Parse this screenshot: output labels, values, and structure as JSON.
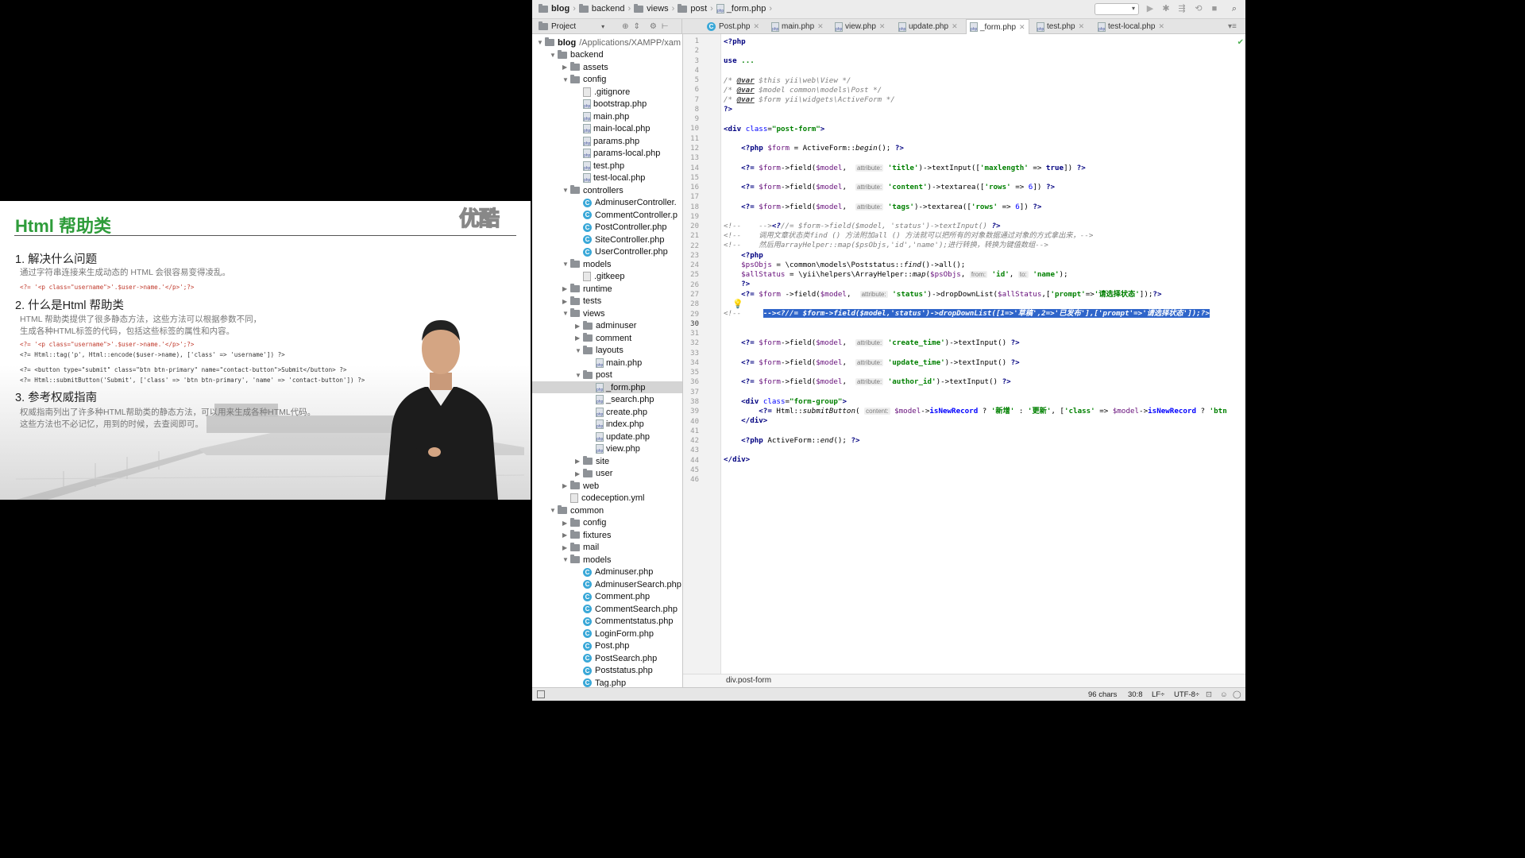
{
  "slide": {
    "title": "Html 帮助类",
    "logo": "优酷",
    "s1_head": "1. 解决什么问题",
    "s1_text": "通过字符串连接来生成动态的 HTML 会很容易变得凌乱。",
    "s1_code": "<?= '<p class=\"username\">'.$user->name.'</p>';?>",
    "s2_head": "2. 什么是Html 帮助类",
    "s2_text1": "HTML 帮助类提供了很多静态方法，这些方法可以根据参数不同，",
    "s2_text2": "生成各种HTML标签的代码，包括这些标签的属性和内容。",
    "s2_code1": "<?= '<p class=\"username\">'.$user->name.'</p>';?>",
    "s2_code2": "<?= Html::tag('p', Html::encode($user->name), ['class' => 'username']) ?>",
    "s2_code3": "<?= <button type=\"submit\" class=\"btn btn-primary\" name=\"contact-button\">Submit</button> ?>",
    "s2_code4": "<?= Html::submitButton('Submit', ['class' => 'btn btn-primary', 'name' => 'contact-button']) ?>",
    "s3_head": "3. 参考权威指南",
    "s3_text1": "权威指南列出了许多种HTML帮助类的静态方法，可以用来生成各种HTML代码。",
    "s3_text2": "这些方法也不必记忆，用到的时候，去查阅即可。"
  },
  "breadcrumb": [
    "blog",
    "backend",
    "views",
    "post",
    "_form.php"
  ],
  "tabs": {
    "project": "Project",
    "files": [
      "Post.php",
      "main.php",
      "view.php",
      "update.php",
      "_form.php",
      "test.php",
      "test-local.php"
    ],
    "active": "_form.php"
  },
  "tree": [
    {
      "label": "blog",
      "extra": "/Applications/XAMPP/xam",
      "depth": 0,
      "kind": "root",
      "open": true
    },
    {
      "label": "backend",
      "depth": 1,
      "kind": "folder",
      "open": true
    },
    {
      "label": "assets",
      "depth": 2,
      "kind": "folder",
      "open": false
    },
    {
      "label": "config",
      "depth": 2,
      "kind": "folder",
      "open": true
    },
    {
      "label": ".gitignore",
      "depth": 3,
      "kind": "file"
    },
    {
      "label": "bootstrap.php",
      "depth": 3,
      "kind": "php"
    },
    {
      "label": "main.php",
      "depth": 3,
      "kind": "php"
    },
    {
      "label": "main-local.php",
      "depth": 3,
      "kind": "php"
    },
    {
      "label": "params.php",
      "depth": 3,
      "kind": "php"
    },
    {
      "label": "params-local.php",
      "depth": 3,
      "kind": "php"
    },
    {
      "label": "test.php",
      "depth": 3,
      "kind": "php"
    },
    {
      "label": "test-local.php",
      "depth": 3,
      "kind": "php"
    },
    {
      "label": "controllers",
      "depth": 2,
      "kind": "folder",
      "open": true
    },
    {
      "label": "AdminuserController.",
      "depth": 3,
      "kind": "class"
    },
    {
      "label": "CommentController.p",
      "depth": 3,
      "kind": "class"
    },
    {
      "label": "PostController.php",
      "depth": 3,
      "kind": "class"
    },
    {
      "label": "SiteController.php",
      "depth": 3,
      "kind": "class"
    },
    {
      "label": "UserController.php",
      "depth": 3,
      "kind": "class"
    },
    {
      "label": "models",
      "depth": 2,
      "kind": "folder",
      "open": true
    },
    {
      "label": ".gitkeep",
      "depth": 3,
      "kind": "file"
    },
    {
      "label": "runtime",
      "depth": 2,
      "kind": "folder",
      "open": false
    },
    {
      "label": "tests",
      "depth": 2,
      "kind": "folder",
      "open": false
    },
    {
      "label": "views",
      "depth": 2,
      "kind": "folder",
      "open": true
    },
    {
      "label": "adminuser",
      "depth": 3,
      "kind": "folder",
      "open": false
    },
    {
      "label": "comment",
      "depth": 3,
      "kind": "folder",
      "open": false
    },
    {
      "label": "layouts",
      "depth": 3,
      "kind": "folder",
      "open": true
    },
    {
      "label": "main.php",
      "depth": 4,
      "kind": "php"
    },
    {
      "label": "post",
      "depth": 3,
      "kind": "folder",
      "open": true
    },
    {
      "label": "_form.php",
      "depth": 4,
      "kind": "php",
      "selected": true
    },
    {
      "label": "_search.php",
      "depth": 4,
      "kind": "php"
    },
    {
      "label": "create.php",
      "depth": 4,
      "kind": "php"
    },
    {
      "label": "index.php",
      "depth": 4,
      "kind": "php"
    },
    {
      "label": "update.php",
      "depth": 4,
      "kind": "php"
    },
    {
      "label": "view.php",
      "depth": 4,
      "kind": "php"
    },
    {
      "label": "site",
      "depth": 3,
      "kind": "folder",
      "open": false
    },
    {
      "label": "user",
      "depth": 3,
      "kind": "folder",
      "open": false
    },
    {
      "label": "web",
      "depth": 2,
      "kind": "folder",
      "open": false
    },
    {
      "label": "codeception.yml",
      "depth": 2,
      "kind": "yml"
    },
    {
      "label": "common",
      "depth": 1,
      "kind": "folder",
      "open": true
    },
    {
      "label": "config",
      "depth": 2,
      "kind": "folder",
      "open": false
    },
    {
      "label": "fixtures",
      "depth": 2,
      "kind": "folder",
      "open": false
    },
    {
      "label": "mail",
      "depth": 2,
      "kind": "folder",
      "open": false
    },
    {
      "label": "models",
      "depth": 2,
      "kind": "folder",
      "open": true
    },
    {
      "label": "Adminuser.php",
      "depth": 3,
      "kind": "class"
    },
    {
      "label": "AdminuserSearch.php",
      "depth": 3,
      "kind": "class"
    },
    {
      "label": "Comment.php",
      "depth": 3,
      "kind": "class"
    },
    {
      "label": "CommentSearch.php",
      "depth": 3,
      "kind": "class"
    },
    {
      "label": "Commentstatus.php",
      "depth": 3,
      "kind": "class"
    },
    {
      "label": "LoginForm.php",
      "depth": 3,
      "kind": "class"
    },
    {
      "label": "Post.php",
      "depth": 3,
      "kind": "class"
    },
    {
      "label": "PostSearch.php",
      "depth": 3,
      "kind": "class"
    },
    {
      "label": "Poststatus.php",
      "depth": 3,
      "kind": "class"
    },
    {
      "label": "Tag.php",
      "depth": 3,
      "kind": "class"
    }
  ],
  "code_lines": 46,
  "current_line": 30,
  "footer_path": "div.post-form",
  "status": {
    "chars": "96 chars",
    "pos": "30:8",
    "le": "LF÷",
    "enc": "UTF-8÷"
  }
}
